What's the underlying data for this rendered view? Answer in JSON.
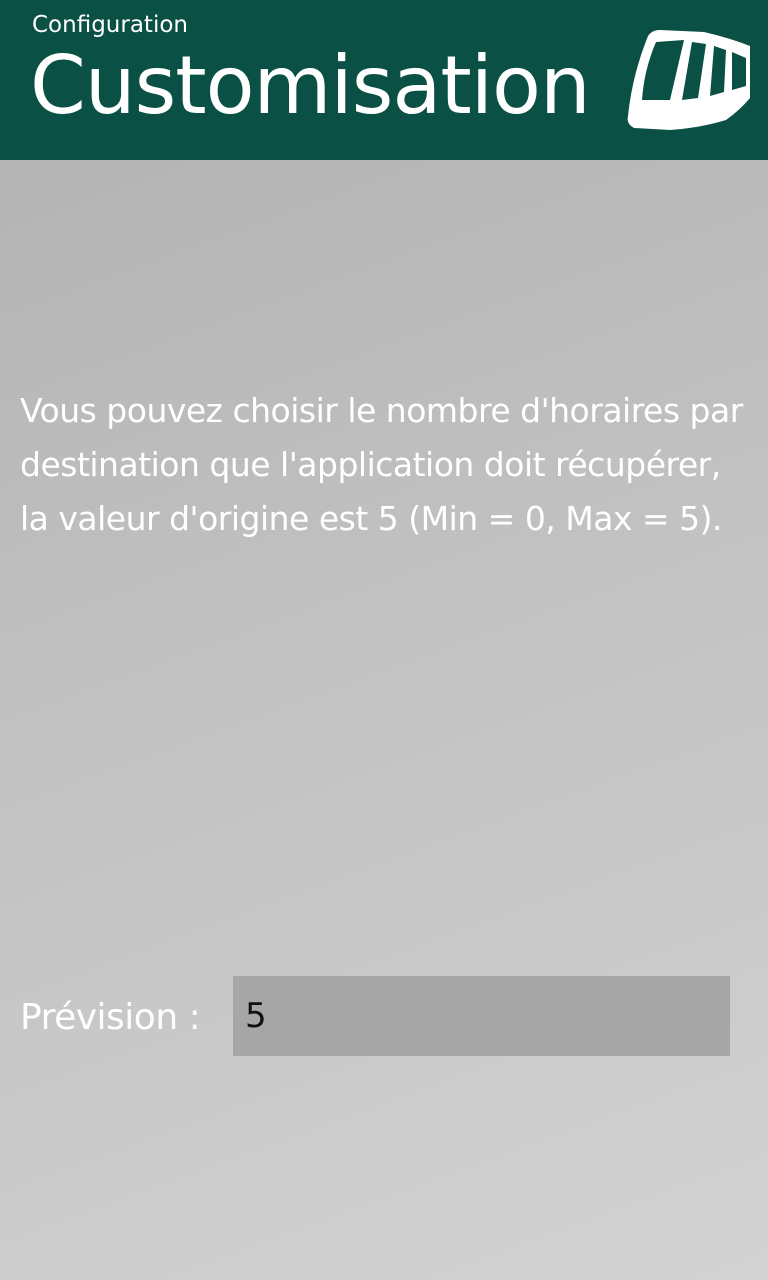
{
  "header": {
    "subtitle": "Configuration",
    "title": "Customisation",
    "icon": "tram-icon"
  },
  "main": {
    "description": "Vous pouvez choisir le nombre d'horaires par destination que l'application doit récupérer, la valeur d'origine est 5 (Min = 0, Max = 5).",
    "forecast_label": "Prévision :",
    "forecast_value": "5"
  },
  "colors": {
    "header_bg": "#0a5044",
    "text": "#ffffff",
    "input_bg": "#a6a6a6"
  }
}
